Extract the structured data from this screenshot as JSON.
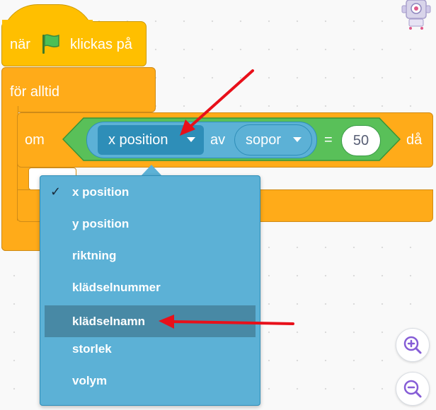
{
  "hat_block": {
    "text_before": "när",
    "flag_icon": "green-flag-icon",
    "text_after": "klickas på"
  },
  "forever_block": {
    "label": "för alltid"
  },
  "if_block": {
    "label_if": "om",
    "label_then": "då"
  },
  "sensing_block": {
    "property_value": "x position",
    "of_label": "av",
    "object_value": "sopor"
  },
  "equals_block": {
    "operator": "=",
    "value": "50"
  },
  "dropdown_menu": {
    "items": [
      {
        "label": "x position",
        "selected": true
      },
      {
        "label": "y position",
        "selected": false
      },
      {
        "label": "riktning",
        "selected": false
      },
      {
        "label": "klädselnummer",
        "selected": false
      },
      {
        "label": "klädselnamn",
        "selected": false,
        "hovered": true
      },
      {
        "label": "storlek",
        "selected": false
      },
      {
        "label": "volym",
        "selected": false
      }
    ],
    "check_mark": "✓"
  },
  "zoom": {
    "in_icon": "zoom-in-icon",
    "out_icon": "zoom-out-icon"
  },
  "colors": {
    "events": "#ffbf00",
    "control": "#ffab19",
    "operators": "#59c059",
    "sensing": "#5cb1d6",
    "sensing_dark": "#2e8eb8",
    "arrow": "#e8101a"
  }
}
